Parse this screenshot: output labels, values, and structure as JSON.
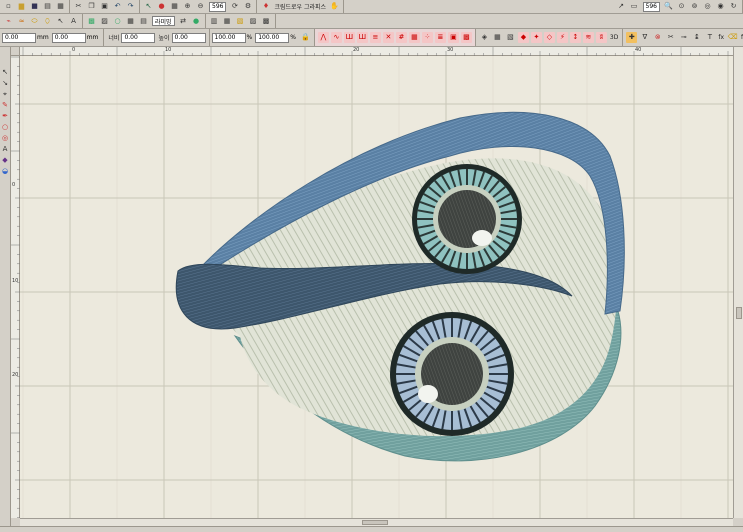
{
  "toolbar_top": {
    "stitch_count": "596",
    "design_label": "크림드로우 그라피스",
    "zoom_value": "596"
  },
  "toolbar_mid": {
    "fill_select": "라미밍"
  },
  "toolbar_props": {
    "x_value": "0.00",
    "y_value": "0.00",
    "width_label": "너비",
    "width_value": "0.00",
    "height_label": "높이",
    "height_value": "0.00",
    "width_pct": "100.00",
    "height_pct": "100.00",
    "pct_unit": "%",
    "mm_unit": "mm",
    "label_3d": "3D",
    "lock_icon": "lock-icon",
    "fx_label": "fx"
  },
  "ruler": {
    "top_ticks": [
      "0",
      "10",
      "20",
      "30",
      "40"
    ],
    "left_ticks": [
      "0",
      "10",
      "20"
    ]
  },
  "colors": {
    "canvas_bg": "#ece9dd",
    "grid_line": "#c9c6b8",
    "outer_blue": "#587fa3",
    "dark_slate": "#3d566c",
    "teal_border": "#6e9d9b",
    "fill_cream": "#dcdfd2",
    "pupil": "#3f4340"
  }
}
